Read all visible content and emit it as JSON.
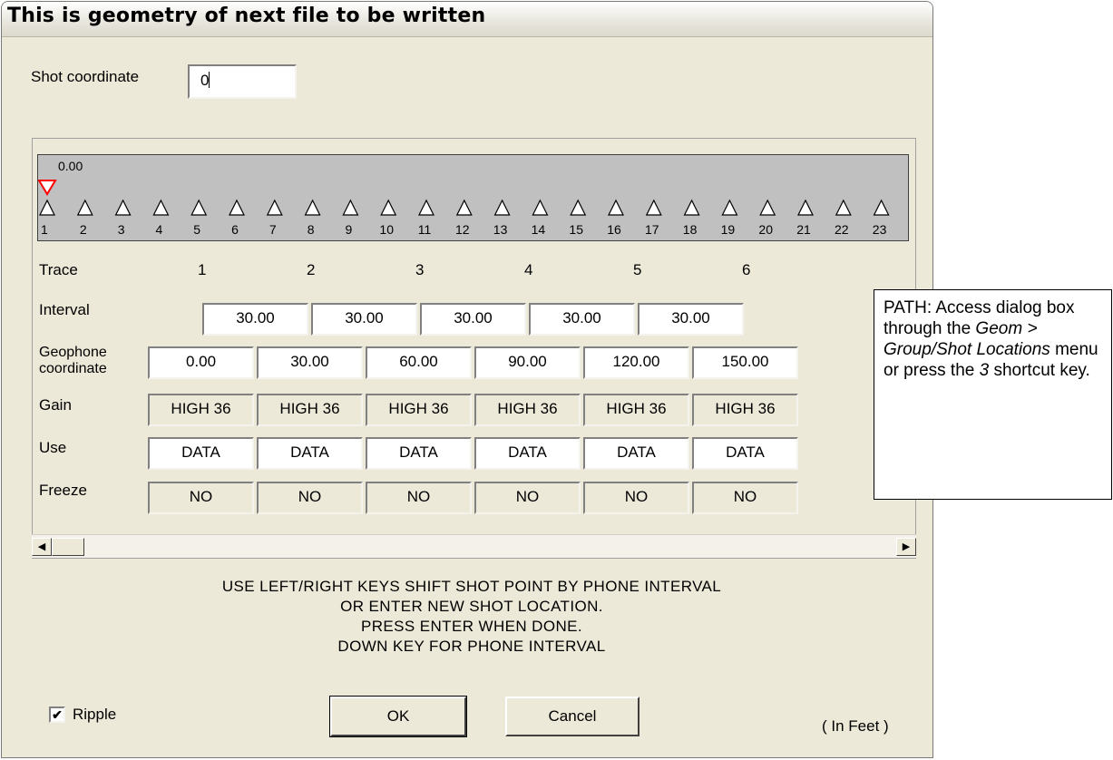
{
  "window": {
    "title": "This is geometry of next file to be written"
  },
  "shot": {
    "label": "Shot coordinate",
    "value": "0"
  },
  "strip": {
    "shot_marker_value": "0.00",
    "phone_numbers": [
      "1",
      "2",
      "3",
      "4",
      "5",
      "6",
      "7",
      "8",
      "9",
      "10",
      "11",
      "12",
      "13",
      "14",
      "15",
      "16",
      "17",
      "18",
      "19",
      "20",
      "21",
      "22",
      "23"
    ]
  },
  "rows": {
    "trace_label": "Trace",
    "interval_label": "Interval",
    "geophone_label_1": "Geophone",
    "geophone_label_2": "coordinate",
    "gain_label": "Gain",
    "use_label": "Use",
    "freeze_label": "Freeze"
  },
  "traces": [
    "1",
    "2",
    "3",
    "4",
    "5",
    "6"
  ],
  "intervals": [
    "30.00",
    "30.00",
    "30.00",
    "30.00",
    "30.00"
  ],
  "geophone_coordinates": [
    "0.00",
    "30.00",
    "60.00",
    "90.00",
    "120.00",
    "150.00"
  ],
  "gains": [
    "HIGH 36",
    "HIGH 36",
    "HIGH 36",
    "HIGH 36",
    "HIGH 36",
    "HIGH 36"
  ],
  "uses": [
    "DATA",
    "DATA",
    "DATA",
    "DATA",
    "DATA",
    "DATA"
  ],
  "freezes": [
    "NO",
    "NO",
    "NO",
    "NO",
    "NO",
    "NO"
  ],
  "instructions": {
    "line1": "USE LEFT/RIGHT KEYS SHIFT SHOT POINT BY PHONE INTERVAL",
    "line2": "OR ENTER NEW SHOT LOCATION.",
    "line3": "PRESS ENTER WHEN DONE.",
    "line4": "DOWN KEY FOR PHONE INTERVAL"
  },
  "footer": {
    "ripple_label": "Ripple",
    "ripple_checked": true,
    "ok_label": "OK",
    "cancel_label": "Cancel",
    "units": "( In Feet )"
  },
  "callout": {
    "t1": "PATH: Access dialog box through the ",
    "t2": "Geom >",
    "t3": " ",
    "t4": "Group/Shot Locations",
    "t5": " menu or press the ",
    "t6": "3",
    "t7": " shortcut key."
  },
  "colors": {
    "dialog_bg": "#ece9d8",
    "strip_bg": "#c0c0c0",
    "shot_marker": "#ff0000"
  }
}
